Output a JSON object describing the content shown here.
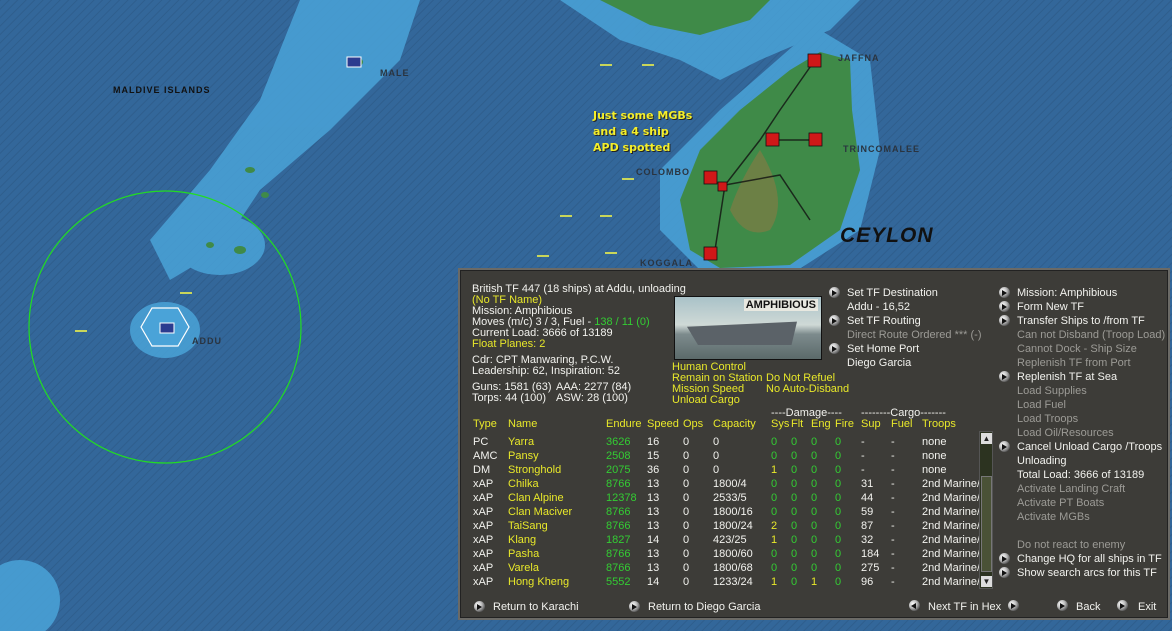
{
  "map": {
    "labels": {
      "maldives": "MALDIVE ISLANDS",
      "male": "MALE",
      "addu": "ADDU",
      "jaffna": "JAFFNA",
      "trincomalee": "TRINCOMALEE",
      "colombo": "COLOMBO",
      "koggala": "KOGGALA",
      "ceylon": "CEYLON"
    },
    "note": [
      "Just some MGBs",
      "and a 4 ship",
      "APD spotted"
    ]
  },
  "panel": {
    "header": "British TF 447 (18 ships) at Addu, unloading",
    "tf_name": "(No TF Name)",
    "mission": "Mission:  Amphibious",
    "moves": "Moves (m/c)  3 / 3, Fuel - ",
    "fuel": "138 / 11 (0)",
    "load": "Current Load:  3666 of 13189",
    "float_planes": "Float Planes: 2",
    "cdr": "Cdr: CPT  Manwaring, P.C.W.",
    "leadership": "Leadership: 62, Inspiration: 52",
    "guns": "Guns: 1581 (63)",
    "aaa": "AAA: 2277 (84)",
    "torps": "Torps: 44 (100)",
    "asw": "ASW: 28 (100)",
    "photo_caption": "AMPHIBIOUS",
    "status": [
      "Human Control",
      "Remain on Station",
      "Mission Speed",
      "Unload Cargo"
    ],
    "status2": [
      "Do Not Refuel",
      "No Auto-Disband"
    ],
    "mid_menu": [
      {
        "label": "Set TF Destination",
        "arrow": true,
        "style": "w"
      },
      {
        "label": "Addu - 16,52",
        "arrow": false,
        "style": "w"
      },
      {
        "label": "Set TF Routing",
        "arrow": true,
        "style": "w"
      },
      {
        "label": "Direct Route Ordered *** (-)",
        "arrow": false,
        "style": "d"
      },
      {
        "label": "Set Home Port",
        "arrow": true,
        "style": "w"
      },
      {
        "label": "Diego Garcia",
        "arrow": false,
        "style": "w"
      }
    ],
    "right_menu": [
      {
        "label": "Mission: Amphibious",
        "arrow": true,
        "style": "w"
      },
      {
        "label": "Form New TF",
        "arrow": true,
        "style": "w"
      },
      {
        "label": "Transfer Ships to /from TF",
        "arrow": true,
        "style": "w"
      },
      {
        "label": "Can not Disband (Troop Load)",
        "arrow": false,
        "style": "d"
      },
      {
        "label": "Cannot Dock - Ship Size",
        "arrow": false,
        "style": "d"
      },
      {
        "label": "Replenish TF from Port",
        "arrow": false,
        "style": "d"
      },
      {
        "label": "Replenish TF at Sea",
        "arrow": true,
        "style": "w"
      },
      {
        "label": "Load Supplies",
        "arrow": false,
        "style": "d"
      },
      {
        "label": "Load Fuel",
        "arrow": false,
        "style": "d"
      },
      {
        "label": "Load Troops",
        "arrow": false,
        "style": "d"
      },
      {
        "label": "Load Oil/Resources",
        "arrow": false,
        "style": "d"
      },
      {
        "label": "Cancel Unload Cargo /Troops",
        "arrow": true,
        "style": "w"
      },
      {
        "label": "Unloading",
        "arrow": false,
        "style": "w"
      },
      {
        "label": "Total Load: 3666 of 13189",
        "arrow": false,
        "style": "w"
      },
      {
        "label": "Activate Landing Craft",
        "arrow": false,
        "style": "d"
      },
      {
        "label": "Activate PT Boats",
        "arrow": false,
        "style": "d"
      },
      {
        "label": "Activate MGBs",
        "arrow": false,
        "style": "d"
      },
      {
        "label": "",
        "arrow": false,
        "style": "d"
      },
      {
        "label": "Do not react to enemy",
        "arrow": false,
        "style": "d"
      },
      {
        "label": "Change HQ for all ships in TF",
        "arrow": true,
        "style": "w"
      },
      {
        "label": "Show search arcs for this TF",
        "arrow": true,
        "style": "w"
      }
    ],
    "table": {
      "group_damage": "----Damage----",
      "group_cargo": "--------Cargo-------",
      "headers": [
        "Type",
        "Name",
        "Endure",
        "Speed",
        "Ops",
        "Capacity",
        "Sys",
        "Flt",
        "Eng",
        "Fire",
        "Sup",
        "Fuel",
        "Troops"
      ],
      "rows": [
        [
          "PC",
          "Yarra",
          "3626",
          "16",
          "0",
          "0",
          "0",
          "0",
          "0",
          "0",
          "-",
          "-",
          "none"
        ],
        [
          "AMC",
          "Pansy",
          "2508",
          "15",
          "0",
          "0",
          "0",
          "0",
          "0",
          "0",
          "-",
          "-",
          "none"
        ],
        [
          "DM",
          "Stronghold",
          "2075",
          "36",
          "0",
          "0",
          "1",
          "0",
          "0",
          "0",
          "-",
          "-",
          "none"
        ],
        [
          "xAP",
          "Chilka",
          "8766",
          "13",
          "0",
          "1800/4",
          "0",
          "0",
          "0",
          "0",
          "31",
          "-",
          "2nd Marine/"
        ],
        [
          "xAP",
          "Clan Alpine",
          "12378",
          "13",
          "0",
          "2533/5",
          "0",
          "0",
          "0",
          "0",
          "44",
          "-",
          "2nd Marine/"
        ],
        [
          "xAP",
          "Clan Maciver",
          "8766",
          "13",
          "0",
          "1800/16",
          "0",
          "0",
          "0",
          "0",
          "59",
          "-",
          "2nd Marine/"
        ],
        [
          "xAP",
          "TaiSang",
          "8766",
          "13",
          "0",
          "1800/24",
          "2",
          "0",
          "0",
          "0",
          "87",
          "-",
          "2nd Marine/"
        ],
        [
          "xAP",
          "Klang",
          "1827",
          "14",
          "0",
          "423/25",
          "1",
          "0",
          "0",
          "0",
          "32",
          "-",
          "2nd Marine/"
        ],
        [
          "xAP",
          "Pasha",
          "8766",
          "13",
          "0",
          "1800/60",
          "0",
          "0",
          "0",
          "0",
          "184",
          "-",
          "2nd Marine/"
        ],
        [
          "xAP",
          "Varela",
          "8766",
          "13",
          "0",
          "1800/68",
          "0",
          "0",
          "0",
          "0",
          "275",
          "-",
          "2nd Marine/"
        ],
        [
          "xAP",
          "Hong Kheng",
          "5552",
          "14",
          "0",
          "1233/24",
          "1",
          "0",
          "1",
          "0",
          "96",
          "-",
          "2nd Marine/"
        ]
      ]
    },
    "footer": {
      "return_karachi": "Return to Karachi",
      "return_diego": "Return to Diego Garcia",
      "next_tf": "Next TF in Hex",
      "back": "Back",
      "exit": "Exit"
    }
  }
}
